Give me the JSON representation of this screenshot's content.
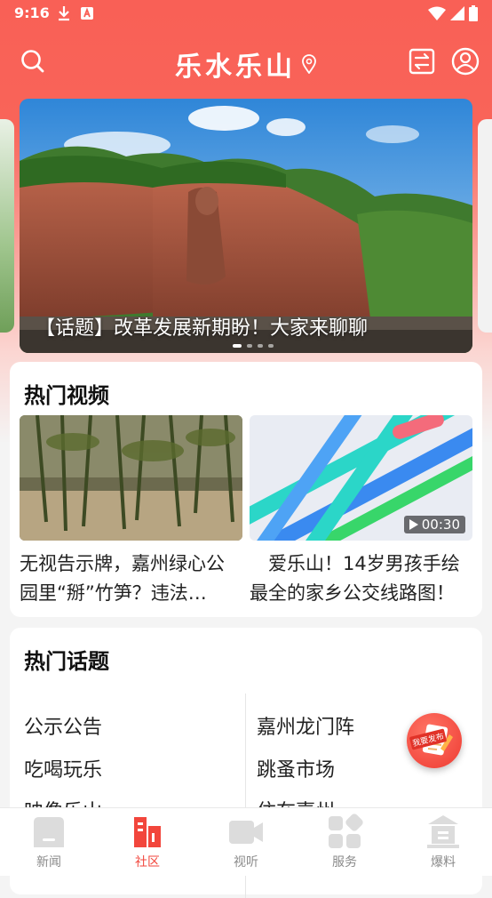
{
  "status_bar": {
    "time": "9:16"
  },
  "header": {
    "title": "乐水乐山"
  },
  "banner": {
    "caption": "【话题】改革发展新期盼！大家来聊聊",
    "dots": 4,
    "active_dot": 1
  },
  "hot_videos": {
    "title": "热门视频",
    "items": [
      {
        "caption": "无视告示牌，嘉州绿心公园里“掰”竹笋？违法…",
        "duration": ""
      },
      {
        "caption": "　爱乐山！14岁男孩手绘最全的家乡公交线路图！",
        "duration": "00:30"
      }
    ]
  },
  "hot_topics": {
    "title": "热门话题",
    "left": [
      "公示公告",
      "吃喝玩乐",
      "映像乐山"
    ],
    "right": [
      "嘉州龙门阵",
      "跳蚤市场",
      "住在嘉州"
    ]
  },
  "fab": {
    "label": "我要发布"
  },
  "tabbar": {
    "tabs": [
      {
        "label": "新闻",
        "icon": "news-icon",
        "active": false
      },
      {
        "label": "社区",
        "icon": "community-icon",
        "active": true
      },
      {
        "label": "视听",
        "icon": "video-camera-icon",
        "active": false
      },
      {
        "label": "服务",
        "icon": "services-grid-icon",
        "active": false
      },
      {
        "label": "爆料",
        "icon": "tip-off-icon",
        "active": false
      }
    ]
  },
  "colors": {
    "brand": "#f96056",
    "active_tab": "#f2463c",
    "inactive_tab": "#8a8a8a"
  }
}
